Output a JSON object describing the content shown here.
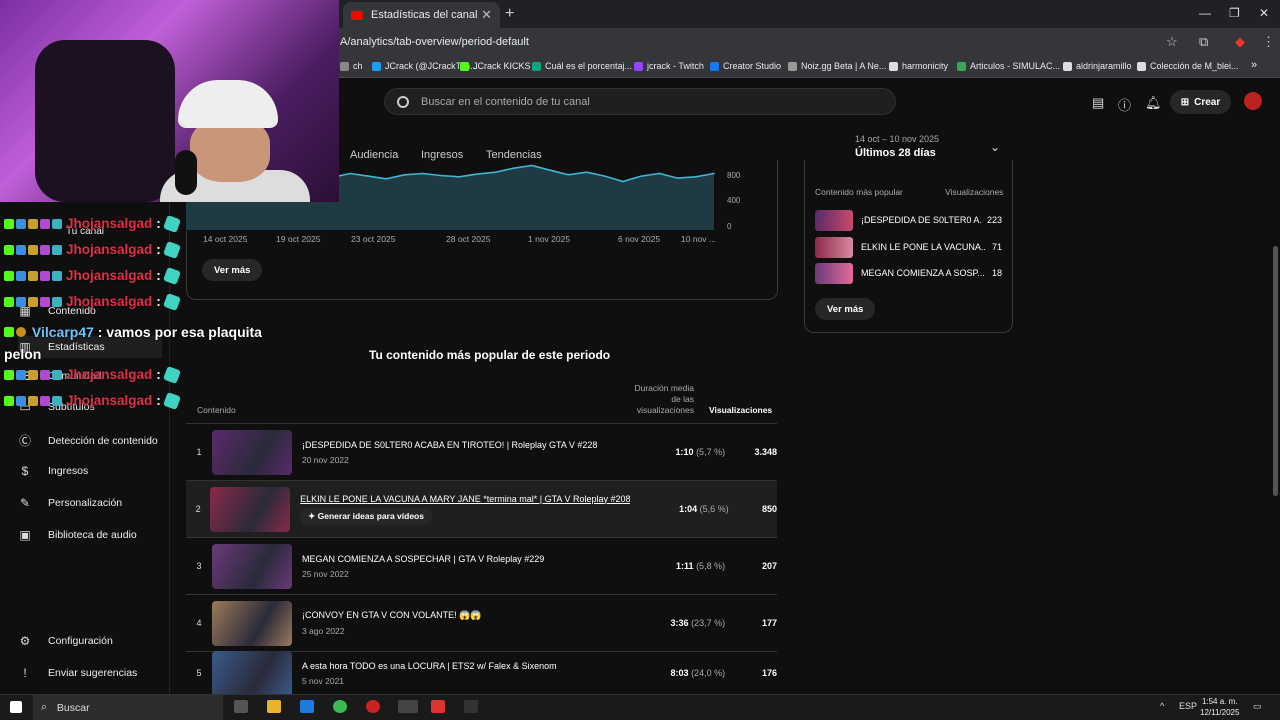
{
  "browser": {
    "tab_title": "Estadísticas del canal - YouTube",
    "new_tab": "+",
    "url": "A/analytics/tab-overview/period-default",
    "bookmarks": [
      {
        "label": "ch",
        "color": "#888"
      },
      {
        "label": "JCrack (@JCrackTV)...",
        "color": "#1d9bf0"
      },
      {
        "label": "JCrack KICKS",
        "color": "#53fc18"
      },
      {
        "label": "Cuál es el porcentaj...",
        "color": "#10a37f"
      },
      {
        "label": "jcrack - Twitch",
        "color": "#9146ff"
      },
      {
        "label": "Creator Studio",
        "color": "#1877f2"
      },
      {
        "label": "Noiz.gg Beta | A Ne...",
        "color": "#999"
      },
      {
        "label": "harmonicity",
        "color": "#ddd"
      },
      {
        "label": "Articulos - SIMULAC...",
        "color": "#34a853"
      },
      {
        "label": "aldrinjaramillo",
        "color": "#ddd"
      },
      {
        "label": "Colección de M_blei...",
        "color": "#ddd"
      }
    ],
    "more": "»"
  },
  "youtube": {
    "search_placeholder": "Buscar en el contenido de tu canal",
    "create_label": "Crear",
    "subtabs": [
      "Audiencia",
      "Ingresos",
      "Tendencias"
    ],
    "period_range": "14 oct – 10 nov 2025",
    "period_label": "Últimos 28 días"
  },
  "sidebar": {
    "channel": "Tu canal",
    "items": [
      {
        "label": "Contenido",
        "icon": "content-icon"
      },
      {
        "label": "Estadísticas",
        "icon": "analytics-icon"
      },
      {
        "label": "Comunidad",
        "icon": "community-icon"
      },
      {
        "label": "Subtítulos",
        "icon": "subtitles-icon"
      },
      {
        "label": "Detección de contenido",
        "icon": "copyright-icon"
      },
      {
        "label": "Ingresos",
        "icon": "dollar-icon"
      },
      {
        "label": "Personalización",
        "icon": "wand-icon"
      },
      {
        "label": "Biblioteca de audio",
        "icon": "audio-library-icon"
      },
      {
        "label": "Configuración",
        "icon": "gear-icon"
      },
      {
        "label": "Enviar sugerencias",
        "icon": "feedback-icon"
      }
    ]
  },
  "chart_data": {
    "type": "area",
    "x_ticks": [
      "14 oct 2025",
      "19 oct 2025",
      "23 oct 2025",
      "28 oct 2025",
      "1 nov 2025",
      "6 nov 2025",
      "10 nov ..."
    ],
    "y_ticks": [
      "800",
      "400",
      "0"
    ],
    "ylim": [
      0,
      1000
    ],
    "color": "#41b4d2",
    "values": [
      740,
      780,
      820,
      800,
      840,
      860,
      900,
      860,
      820,
      880,
      840,
      800,
      860,
      880,
      850,
      830,
      870,
      900,
      960,
      1000,
      930,
      860,
      900,
      840,
      760,
      840,
      880,
      810,
      830,
      880
    ]
  },
  "ver_mas": "Ver más",
  "popular_card": {
    "header_left": "Contenido más popular",
    "header_right": "Visualizaciones",
    "rows": [
      {
        "title": "¡DESPEDIDA DE S0LTER0 A...",
        "views": "223"
      },
      {
        "title": "ELKIN LE PONE LA VACUNA...",
        "views": "71"
      },
      {
        "title": "MEGAN COMIENZA A SOSP...",
        "views": "18"
      }
    ],
    "button": "Ver más"
  },
  "table": {
    "title": "Tu contenido más popular de este periodo",
    "col_content": "Contenido",
    "col_duration": [
      "Duración media",
      "de las",
      "visualizaciones"
    ],
    "col_views": "Visualizaciones",
    "generate_label": "✦ Generar ideas para vídeos",
    "rows": [
      {
        "rank": "1",
        "title": "¡DESPEDIDA DE S0LTER0 ACABA EN TIROTEO! | Roleplay GTA V #228",
        "date": "20 nov 2022",
        "dur": "1:10",
        "pct": "(5,7 %)",
        "views": "3.348",
        "thumb": "#5a2a6a"
      },
      {
        "rank": "2",
        "title": "ELKIN LE PONE LA VACUNA A MARY JANE *termina mal* | GTA V Roleplay #208",
        "date": "",
        "dur": "1:04",
        "pct": "(5,6 %)",
        "views": "850",
        "thumb": "#8a2a4a"
      },
      {
        "rank": "3",
        "title": "MEGAN COMIENZA A SOSPECHAR | GTA V Roleplay #229",
        "date": "25 nov 2022",
        "dur": "1:11",
        "pct": "(5,8 %)",
        "views": "207",
        "thumb": "#6a3a7a"
      },
      {
        "rank": "4",
        "title": "¡CONVOY EN GTA V CON VOLANTE! 😱😱",
        "date": "3 ago 2022",
        "dur": "3:36",
        "pct": "(23,7 %)",
        "views": "177",
        "thumb": "#9a7a5a"
      },
      {
        "rank": "5",
        "title": "A esta hora TODO es una LOCURA | ETS2 w/ Falex & Sixenom",
        "date": "5 nov 2021",
        "dur": "8:03",
        "pct": "(24,0 %)",
        "views": "176",
        "thumb": "#3a5a8a"
      }
    ]
  },
  "chat": {
    "user": "Jhojansalgad",
    "colon": ":",
    "line_count": 6,
    "vil_user": "Vilcarp47",
    "vil_msg": ": vamos por esa plaquita pelon"
  },
  "taskbar": {
    "search": "Buscar",
    "lang": "ESP",
    "time": "1:54 a. m.",
    "date": "12/11/2025"
  }
}
